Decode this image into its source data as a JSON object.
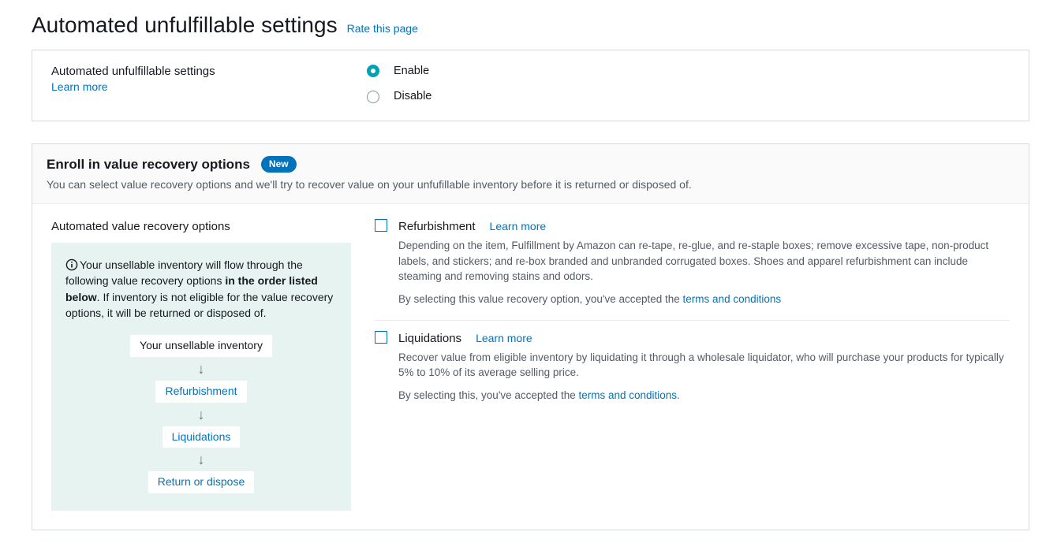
{
  "header": {
    "title": "Automated unfulfillable settings",
    "rate_link": "Rate this page"
  },
  "settings_panel": {
    "label": "Automated unfulfillable settings",
    "learn_more": "Learn more",
    "radio": {
      "enable": "Enable",
      "disable": "Disable",
      "selected": "enable"
    }
  },
  "enroll_panel": {
    "title": "Enroll in value recovery options",
    "badge": "New",
    "subtitle": "You can select value recovery options and we'll try to recover value on your unfufillable inventory before it is returned or disposed of.",
    "left": {
      "heading": "Automated value recovery options",
      "info_pre": "Your unsellable inventory will flow through the following value recovery options ",
      "info_bold": "in the order listed below",
      "info_post": ". If inventory is not eligible for the value recovery options, it will be returned or disposed of.",
      "flow": {
        "start": "Your unsellable inventory",
        "step1": "Refurbishment",
        "step2": "Liquidations",
        "end": "Return or dispose"
      }
    },
    "options": {
      "refurbishment": {
        "title": "Refurbishment",
        "learn_more": "Learn more",
        "desc": "Depending on the item, Fulfillment by Amazon can re-tape, re-glue, and re-staple boxes; remove excessive tape, non-product labels, and stickers; and re-box branded and unbranded corrugated boxes. Shoes and apparel refurbishment can include steaming and removing stains and odors.",
        "accept_pre": "By selecting this value recovery option, you've accepted the ",
        "terms": "terms and conditions"
      },
      "liquidations": {
        "title": "Liquidations",
        "learn_more": "Learn more",
        "desc": "Recover value from eligible inventory by liquidating it through a wholesale liquidator, who will purchase your products for typically 5% to 10% of its average selling price.",
        "accept_pre": "By selecting this, you've accepted the ",
        "terms": "terms and conditions",
        "period": "."
      }
    }
  }
}
